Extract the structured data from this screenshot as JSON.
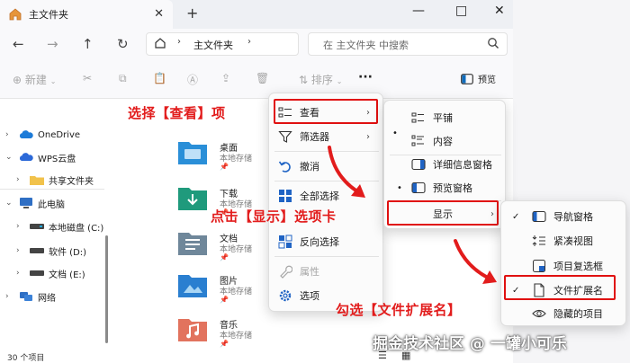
{
  "window": {
    "tab_title": "主文件夹",
    "new_tab": "+",
    "close_tab": "✕",
    "minimize": "—",
    "maximize": "□",
    "close": "✕"
  },
  "address_bar": {
    "path": "主文件夹",
    "search_placeholder": "在 主文件夹 中搜索"
  },
  "toolbar": {
    "new_label": "新建",
    "sort_label": "排序",
    "more_label": "···",
    "preview_label": "预览"
  },
  "sidebar": {
    "items": [
      {
        "label": "OneDrive",
        "icon": "cloud-icon"
      },
      {
        "label": "WPS云盘",
        "icon": "cloud-icon"
      },
      {
        "label": "共享文件夹",
        "icon": "folder-icon"
      },
      {
        "label": "此电脑",
        "icon": "computer-icon"
      },
      {
        "label": "本地磁盘 (C:)",
        "icon": "drive-icon"
      },
      {
        "label": "软件 (D:)",
        "icon": "drive-icon"
      },
      {
        "label": "文档 (E:)",
        "icon": "drive-icon"
      },
      {
        "label": "网络",
        "icon": "network-icon"
      }
    ]
  },
  "files": [
    {
      "name": "桌面",
      "sub": "本地存储",
      "pin": "📌",
      "icon": "desktop-folder-icon",
      "color": "#2a8fd8"
    },
    {
      "name": "下载",
      "sub": "本地存储",
      "pin": "📌",
      "icon": "download-folder-icon",
      "color": "#1f9a7c"
    },
    {
      "name": "文档",
      "sub": "本地存储",
      "pin": "📌",
      "icon": "documents-folder-icon",
      "color": "#6f879a"
    },
    {
      "name": "图片",
      "sub": "本地存储",
      "pin": "📌",
      "icon": "pictures-folder-icon",
      "color": "#2a7fd0"
    },
    {
      "name": "音乐",
      "sub": "本地存储",
      "pin": "📌",
      "icon": "music-folder-icon",
      "color": "#e2735e"
    }
  ],
  "status_bar": {
    "item_count": "30 个项目"
  },
  "context_menu": {
    "items": [
      "查看",
      "筛选器",
      "撤消",
      "全部选择",
      "反向选择",
      "属性",
      "选项"
    ]
  },
  "view_submenu": {
    "items": [
      "平铺",
      "内容",
      "详细信息窗格",
      "预览窗格",
      "显示"
    ],
    "bullet": "•"
  },
  "show_submenu": {
    "items": [
      "导航窗格",
      "紧凑视图",
      "项目复选框",
      "文件扩展名",
      "隐藏的项目"
    ],
    "check": "✓"
  },
  "annotations": {
    "step1": "选择【查看】项",
    "step2": "点击【显示】选项卡",
    "step3": "勾选【文件扩展名】"
  },
  "watermark": "掘金技术社区 @ 一罐小可乐",
  "colors": {
    "annotation_red": "#e21c1c",
    "accent_blue": "#0f6cbd"
  }
}
